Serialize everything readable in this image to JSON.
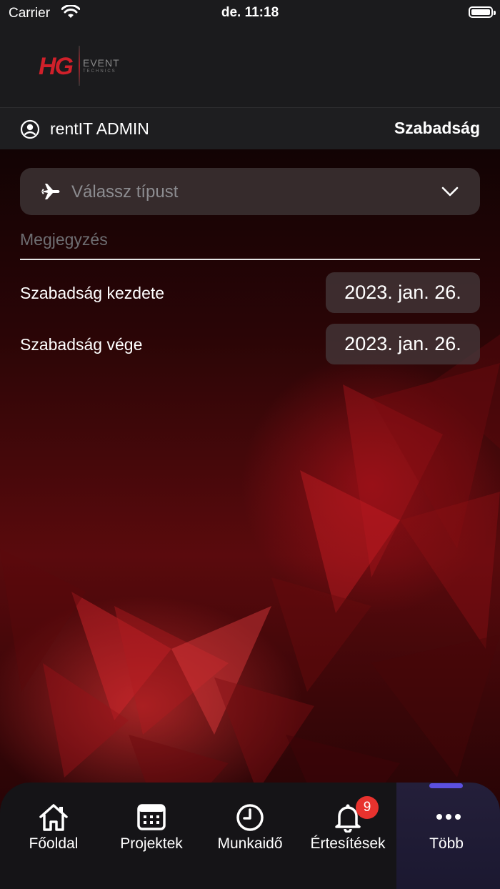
{
  "status_bar": {
    "carrier": "Carrier",
    "time": "de. 11:18"
  },
  "logo": {
    "mark": "HG",
    "event": "EVENT",
    "tagline": "TECHNICS"
  },
  "user_bar": {
    "user_name": "rentIT ADMIN",
    "page_title": "Szabadság"
  },
  "form": {
    "type_select": {
      "placeholder": "Válassz típust",
      "icon": "airplane-icon"
    },
    "note": {
      "placeholder": "Megjegyzés"
    },
    "start": {
      "label": "Szabadság kezdete",
      "value": "2023. jan. 26."
    },
    "end": {
      "label": "Szabadság vége",
      "value": "2023. jan. 26."
    }
  },
  "tab_bar": {
    "tabs": [
      {
        "label": "Főoldal",
        "icon": "home-icon"
      },
      {
        "label": "Projektek",
        "icon": "calendar-icon"
      },
      {
        "label": "Munkaidő",
        "icon": "clock-icon"
      },
      {
        "label": "Értesítések",
        "icon": "bell-icon",
        "badge": "9"
      },
      {
        "label": "Több",
        "icon": "more-icon",
        "active": true
      }
    ]
  },
  "colors": {
    "accent": "#5b50e0",
    "badge": "#e8322e",
    "brand_red": "#d0202a"
  }
}
